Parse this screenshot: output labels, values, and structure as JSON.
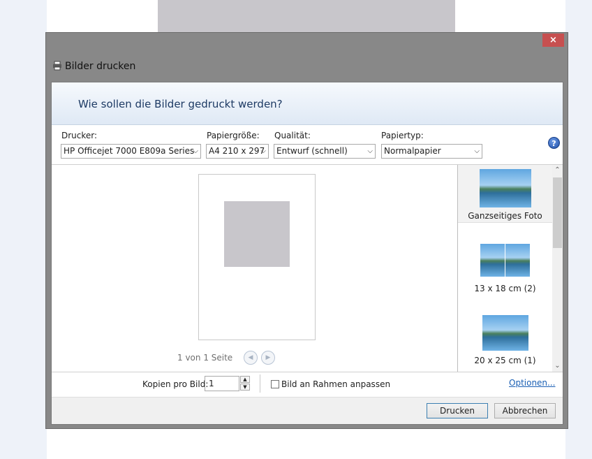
{
  "window": {
    "title": "Bilder drucken",
    "close_glyph": "×"
  },
  "header": {
    "question": "Wie sollen die Bilder gedruckt werden?"
  },
  "options": {
    "printer": {
      "label": "Drucker:",
      "value": "HP Officejet 7000 E809a Series"
    },
    "paper_size": {
      "label": "Papiergröße:",
      "value": "A4 210 x 297"
    },
    "quality": {
      "label": "Qualität:",
      "value": "Entwurf (schnell)"
    },
    "paper_type": {
      "label": "Papiertyp:",
      "value": "Normalpapier"
    },
    "help_glyph": "?",
    "dropdown_glyph": "⌵"
  },
  "preview": {
    "page_count": "1 von 1 Seite",
    "prev_glyph": "◀",
    "next_glyph": "▶"
  },
  "layouts": [
    {
      "label": "Ganzseitiges Foto",
      "selected": true
    },
    {
      "label": "13 x 18 cm (2)",
      "selected": false
    },
    {
      "label": "20 x 25 cm (1)",
      "selected": false
    }
  ],
  "scrollbar": {
    "up_glyph": "⌃",
    "down_glyph": "⌄"
  },
  "bottom": {
    "copies_label": "Kopien pro Bild:",
    "copies_value": "1",
    "spin_up": "▲",
    "spin_down": "▼",
    "fit_label": "Bild an Rahmen anpassen",
    "options_link": "Optionen..."
  },
  "footer": {
    "print_button": "Drucken",
    "cancel_button": "Abbrechen"
  },
  "colors": {
    "window_frame": "#888888",
    "close_button": "#c75050",
    "header_text": "#1d3a64",
    "link": "#1a5fb4"
  }
}
